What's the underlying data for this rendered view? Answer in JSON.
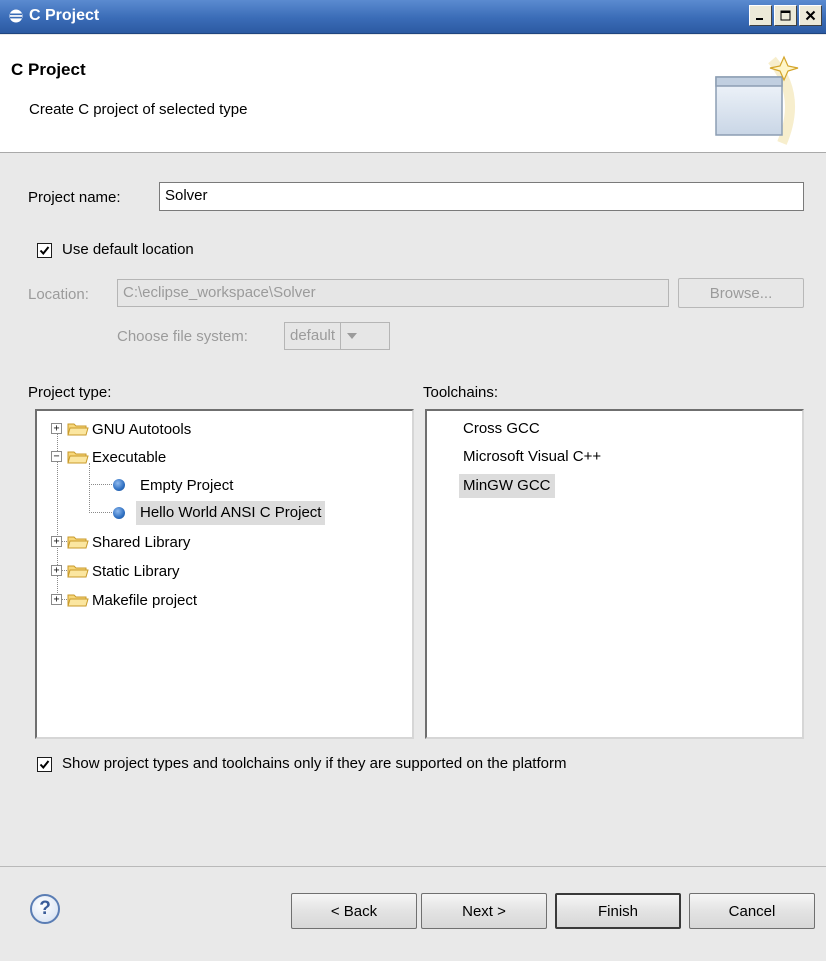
{
  "window": {
    "title": "C Project"
  },
  "header": {
    "title": "C Project",
    "description": "Create C project of selected type"
  },
  "form": {
    "project_name_label": "Project name:",
    "project_name_value": "Solver",
    "use_default_location_label": "Use default location",
    "use_default_location_checked": true,
    "location_label": "Location:",
    "location_value": "C:\\eclipse_workspace\\Solver",
    "browse_label": "Browse...",
    "file_system_label": "Choose file system:",
    "file_system_value": "default"
  },
  "project_type": {
    "label": "Project type:",
    "items": [
      {
        "label": "GNU Autotools",
        "kind": "folder",
        "expanded": false
      },
      {
        "label": "Executable",
        "kind": "folder",
        "expanded": true
      },
      {
        "label": "Empty Project",
        "kind": "leaf"
      },
      {
        "label": "Hello World ANSI C Project",
        "kind": "leaf",
        "selected": true
      },
      {
        "label": "Shared Library",
        "kind": "folder",
        "expanded": false
      },
      {
        "label": "Static Library",
        "kind": "folder",
        "expanded": false
      },
      {
        "label": "Makefile project",
        "kind": "folder",
        "expanded": false
      }
    ]
  },
  "toolchains": {
    "label": "Toolchains:",
    "items": [
      {
        "label": "Cross GCC"
      },
      {
        "label": "Microsoft Visual C++"
      },
      {
        "label": "MinGW GCC",
        "selected": true
      }
    ]
  },
  "options": {
    "show_supported_label": "Show project types and toolchains only if they are supported on the platform",
    "show_supported_checked": true
  },
  "buttons": {
    "help": "?",
    "back": "< Back",
    "next": "Next >",
    "finish": "Finish",
    "cancel": "Cancel"
  },
  "colors": {
    "titlebar": "#3a6cb7",
    "selection": "#dcdcdc",
    "dialog_bg": "#e9e9e9"
  },
  "icons": [
    "eclipse-icon",
    "minimize-icon",
    "maximize-icon",
    "close-icon",
    "wizard-banner-icon",
    "checkbox-check-icon",
    "dropdown-arrow-icon",
    "folder-icon",
    "project-node-icon",
    "help-icon"
  ]
}
